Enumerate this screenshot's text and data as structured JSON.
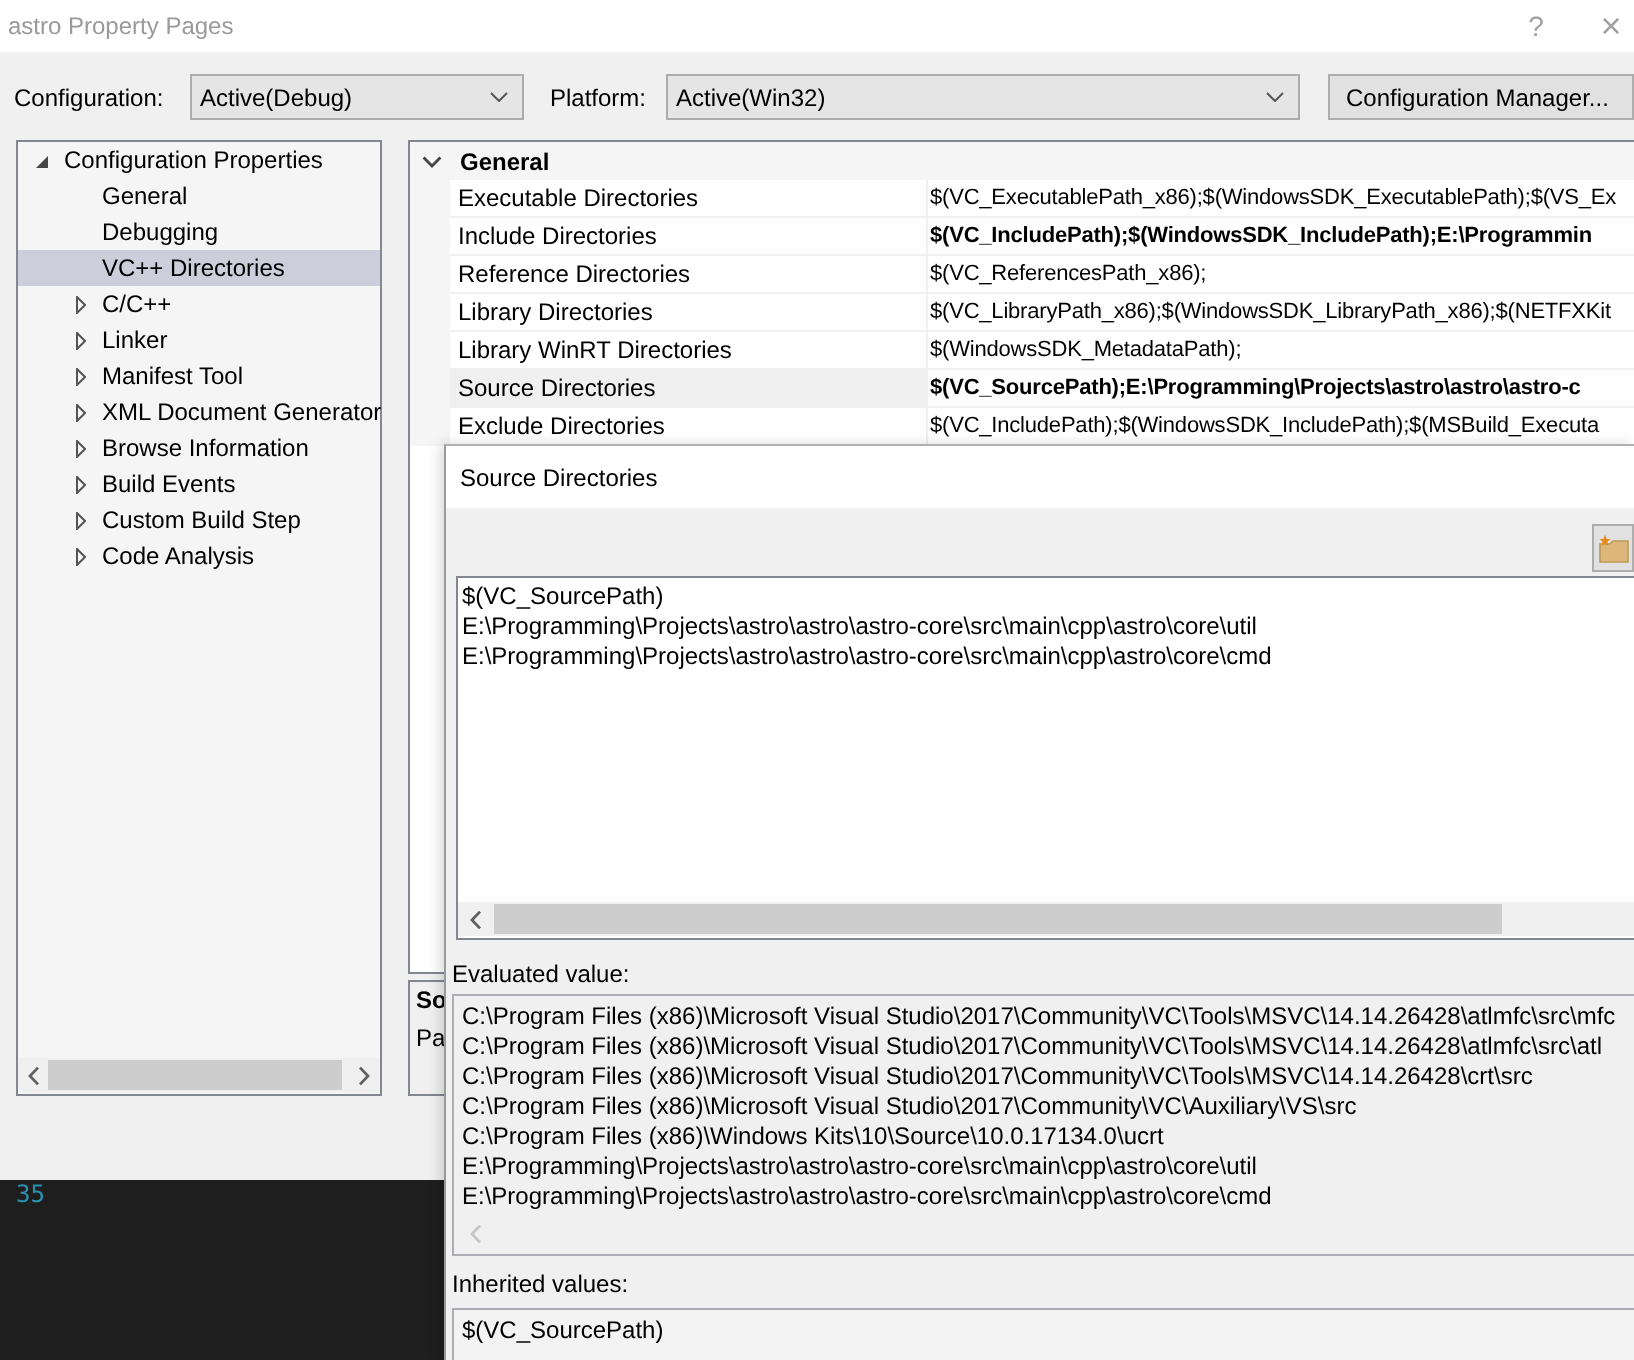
{
  "window": {
    "title": "astro Property Pages",
    "help_button": "?",
    "close_button": "×"
  },
  "toolbar": {
    "configuration_label": "Configuration:",
    "configuration_value": "Active(Debug)",
    "platform_label": "Platform:",
    "platform_value": "Active(Win32)",
    "manager_button": "Configuration Manager..."
  },
  "tree": {
    "items": [
      {
        "label": "Configuration Properties",
        "kind": "group",
        "expanded": true,
        "selected": false,
        "children": [
          {
            "label": "General",
            "kind": "page",
            "selected": false
          },
          {
            "label": "Debugging",
            "kind": "page",
            "selected": false
          },
          {
            "label": "VC++ Directories",
            "kind": "page",
            "selected": true
          },
          {
            "label": "C/C++",
            "kind": "group",
            "expanded": false,
            "selected": false
          },
          {
            "label": "Linker",
            "kind": "group",
            "expanded": false,
            "selected": false
          },
          {
            "label": "Manifest Tool",
            "kind": "group",
            "expanded": false,
            "selected": false
          },
          {
            "label": "XML Document Generator",
            "kind": "group",
            "expanded": false,
            "selected": false
          },
          {
            "label": "Browse Information",
            "kind": "group",
            "expanded": false,
            "selected": false
          },
          {
            "label": "Build Events",
            "kind": "group",
            "expanded": false,
            "selected": false
          },
          {
            "label": "Custom Build Step",
            "kind": "group",
            "expanded": false,
            "selected": false
          },
          {
            "label": "Code Analysis",
            "kind": "group",
            "expanded": false,
            "selected": false
          }
        ]
      }
    ]
  },
  "property_grid": {
    "section": {
      "title": "General",
      "expanded": true
    },
    "rows": [
      {
        "name": "Executable Directories",
        "value": "$(VC_ExecutablePath_x86);$(WindowsSDK_ExecutablePath);$(VS_Ex",
        "modified": false,
        "selected": false
      },
      {
        "name": "Include Directories",
        "value": "$(VC_IncludePath);$(WindowsSDK_IncludePath);E:\\Programmin",
        "modified": true,
        "selected": false
      },
      {
        "name": "Reference Directories",
        "value": "$(VC_ReferencesPath_x86);",
        "modified": false,
        "selected": false
      },
      {
        "name": "Library Directories",
        "value": "$(VC_LibraryPath_x86);$(WindowsSDK_LibraryPath_x86);$(NETFXKit",
        "modified": false,
        "selected": false
      },
      {
        "name": "Library WinRT Directories",
        "value": "$(WindowsSDK_MetadataPath);",
        "modified": false,
        "selected": false
      },
      {
        "name": "Source Directories",
        "value": "$(VC_SourcePath);E:\\Programming\\Projects\\astro\\astro\\astro-c",
        "modified": true,
        "selected": true
      },
      {
        "name": "Exclude Directories",
        "value": "$(VC_IncludePath);$(WindowsSDK_IncludePath);$(MSBuild_Executa",
        "modified": false,
        "selected": false
      }
    ]
  },
  "description": {
    "title": "So",
    "text": "Pa"
  },
  "editor": {
    "line_number": "35"
  },
  "dialog": {
    "title": "Source Directories",
    "entries": [
      "$(VC_SourcePath)",
      "E:\\Programming\\Projects\\astro\\astro\\astro-core\\src\\main\\cpp\\astro\\core\\util",
      "E:\\Programming\\Projects\\astro\\astro\\astro-core\\src\\main\\cpp\\astro\\core\\cmd"
    ],
    "evaluated_label": "Evaluated value:",
    "evaluated_lines": [
      "C:\\Program Files (x86)\\Microsoft Visual Studio\\2017\\Community\\VC\\Tools\\MSVC\\14.14.26428\\atlmfc\\src\\mfc",
      "C:\\Program Files (x86)\\Microsoft Visual Studio\\2017\\Community\\VC\\Tools\\MSVC\\14.14.26428\\atlmfc\\src\\atl",
      "C:\\Program Files (x86)\\Microsoft Visual Studio\\2017\\Community\\VC\\Tools\\MSVC\\14.14.26428\\crt\\src",
      "C:\\Program Files (x86)\\Microsoft Visual Studio\\2017\\Community\\VC\\Auxiliary\\VS\\src",
      "C:\\Program Files (x86)\\Windows Kits\\10\\Source\\10.0.17134.0\\ucrt",
      "E:\\Programming\\Projects\\astro\\astro\\astro-core\\src\\main\\cpp\\astro\\core\\util",
      "E:\\Programming\\Projects\\astro\\astro\\astro-core\\src\\main\\cpp\\astro\\core\\cmd"
    ],
    "inherited_label": "Inherited values:",
    "inherited_lines": [
      "$(VC_SourcePath)"
    ]
  }
}
